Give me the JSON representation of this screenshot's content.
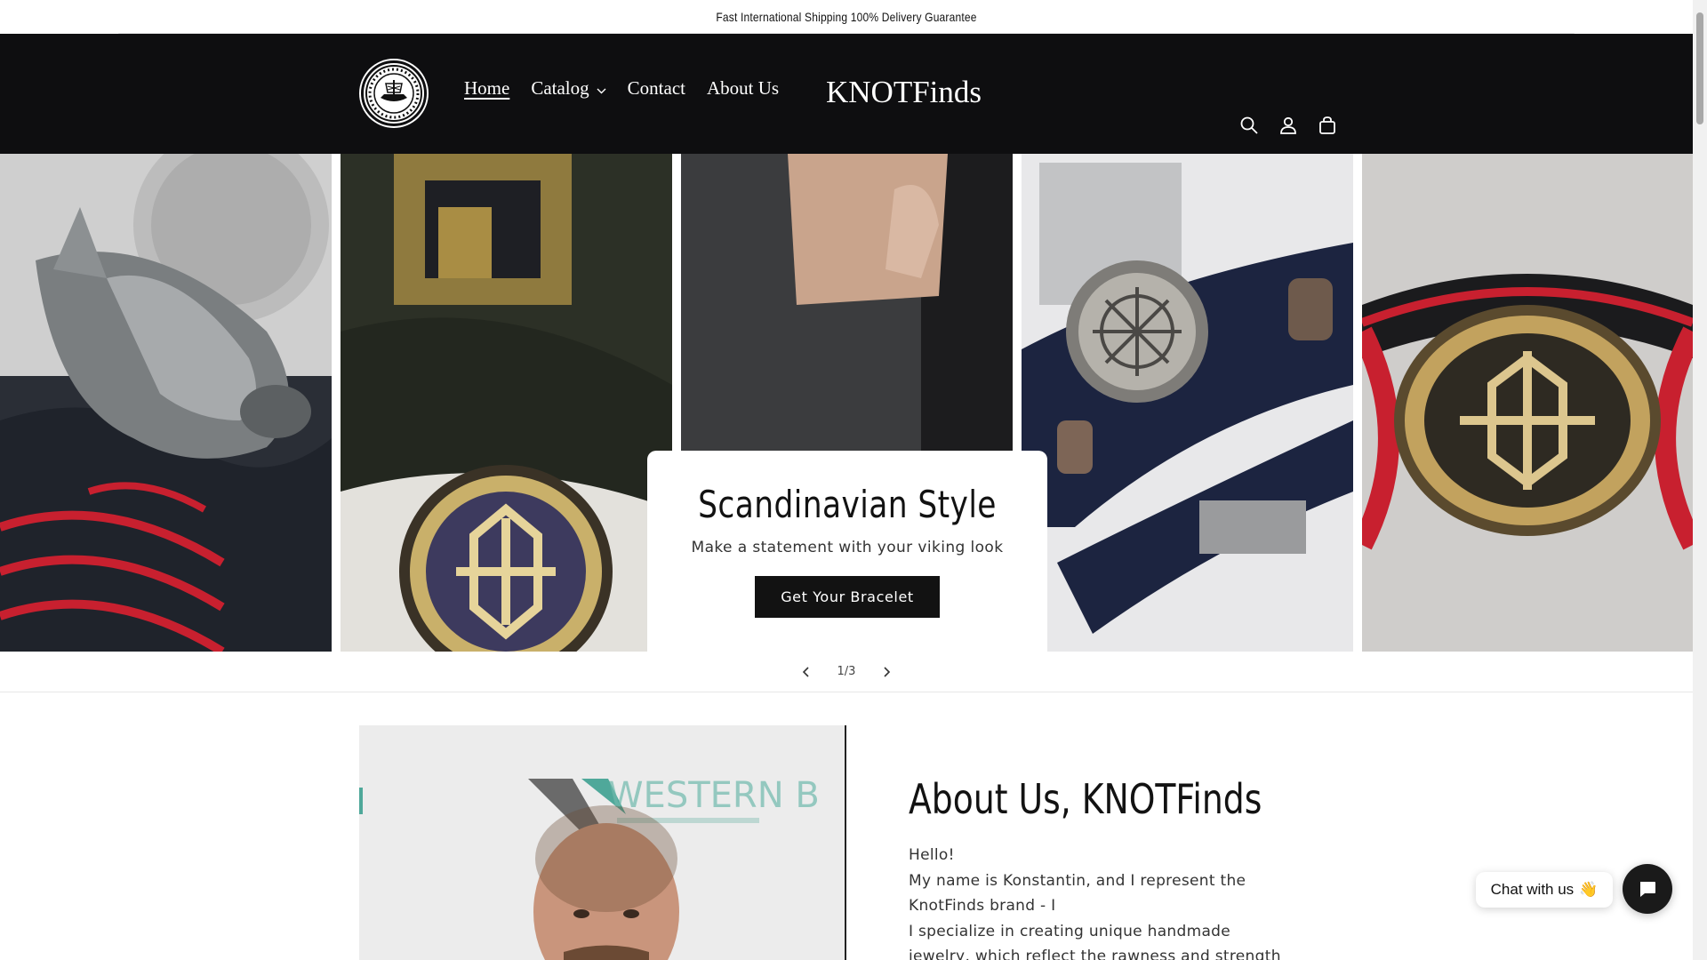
{
  "announcement": {
    "text": "Fast International Shipping 100% Delivery Guarantee"
  },
  "header": {
    "logo": {
      "icon": "knotfinds-viking-logo",
      "lettering": "KNOT FINDS · VIKING · PARACORD BRACELET"
    },
    "nav": [
      {
        "label": "Home",
        "active": true
      },
      {
        "label": "Catalog",
        "has_dropdown": true
      },
      {
        "label": "Contact"
      },
      {
        "label": "About Us"
      }
    ],
    "brand": "KNOTFinds",
    "icons": [
      "search-icon",
      "account-icon",
      "cart-icon"
    ]
  },
  "hero": {
    "title": "Scandinavian Style",
    "subtitle": "Make a statement with your viking look",
    "button_label": "Get Your Bracelet",
    "slider": {
      "counter": "1/3",
      "current": 1,
      "total": 3
    }
  },
  "about": {
    "title": "About Us, KNOTFinds",
    "paragraphs": [
      "Hello!",
      "My name is Konstantin, and I represent the KnotFinds brand - I",
      "I specialize in creating unique handmade jewelry, which reflect the rawness and strength of"
    ],
    "image_text": "WESTERN B"
  },
  "chat": {
    "label": "Chat with us",
    "emoji": "👋"
  },
  "colors": {
    "header_bg": "#0e0e10",
    "button_bg": "#121212",
    "accent_red": "#c8202f",
    "cord_navy": "#1c2440"
  }
}
